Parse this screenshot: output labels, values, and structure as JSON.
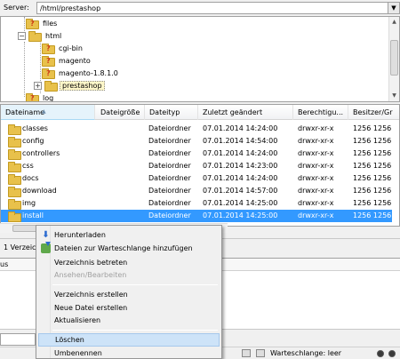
{
  "pathbar": {
    "label": "Server:",
    "value": "/html/prestashop"
  },
  "tree": {
    "items": [
      {
        "label": "files",
        "unknown": true
      },
      {
        "label": "html",
        "unknown": false
      },
      {
        "label": "cgi-bin",
        "unknown": true
      },
      {
        "label": "magento",
        "unknown": true
      },
      {
        "label": "magento-1.8.1.0",
        "unknown": true
      },
      {
        "label": "prestashop",
        "unknown": false,
        "selected": true
      },
      {
        "label": "log",
        "unknown": true
      }
    ]
  },
  "filelist": {
    "columns": [
      "Dateiname",
      "Dateigröße",
      "Dateityp",
      "Zuletzt geändert",
      "Berechtigu...",
      "Besitzer/Gr"
    ],
    "rows": [
      {
        "name": "classes",
        "type": "Dateiordner",
        "date": "07.01.2014 14:24:00",
        "perm": "drwxr-xr-x",
        "owner": "1256 1256"
      },
      {
        "name": "config",
        "type": "Dateiordner",
        "date": "07.01.2014 14:54:00",
        "perm": "drwxr-xr-x",
        "owner": "1256 1256"
      },
      {
        "name": "controllers",
        "type": "Dateiordner",
        "date": "07.01.2014 14:24:00",
        "perm": "drwxr-xr-x",
        "owner": "1256 1256"
      },
      {
        "name": "css",
        "type": "Dateiordner",
        "date": "07.01.2014 14:23:00",
        "perm": "drwxr-xr-x",
        "owner": "1256 1256"
      },
      {
        "name": "docs",
        "type": "Dateiordner",
        "date": "07.01.2014 14:24:00",
        "perm": "drwxr-xr-x",
        "owner": "1256 1256"
      },
      {
        "name": "download",
        "type": "Dateiordner",
        "date": "07.01.2014 14:57:00",
        "perm": "drwxr-xr-x",
        "owner": "1256 1256"
      },
      {
        "name": "img",
        "type": "Dateiordner",
        "date": "07.01.2014 14:25:00",
        "perm": "drwxr-xr-x",
        "owner": "1256 1256"
      },
      {
        "name": "install",
        "type": "Dateiordner",
        "date": "07.01.2014 14:25:00",
        "perm": "drwxr-xr-x",
        "owner": "1256 1256",
        "selected": true
      }
    ],
    "status": "1 Verzeic"
  },
  "queue": {
    "header": "us"
  },
  "statusbar": {
    "queue_status": "Warteschlange: leer"
  },
  "context_menu": {
    "items": [
      {
        "label": "Herunterladen",
        "icon": "download-icon"
      },
      {
        "label": "Dateien zur Warteschlange hinzufügen",
        "icon": "add-to-queue-icon"
      },
      {
        "label": "Verzeichnis betreten"
      },
      {
        "label": "Ansehen/Bearbeiten",
        "disabled": true
      },
      {
        "label": "Verzeichnis erstellen"
      },
      {
        "label": "Neue Datei erstellen"
      },
      {
        "label": "Aktualisieren"
      },
      {
        "label": "Löschen",
        "hover": true
      },
      {
        "label": "Umbenennen"
      }
    ]
  },
  "colors": {
    "selection": "#3399ff",
    "menu_hover": "#cde3f8",
    "folder": "#e8c14b",
    "unknown_mark": "#d03a1b"
  }
}
